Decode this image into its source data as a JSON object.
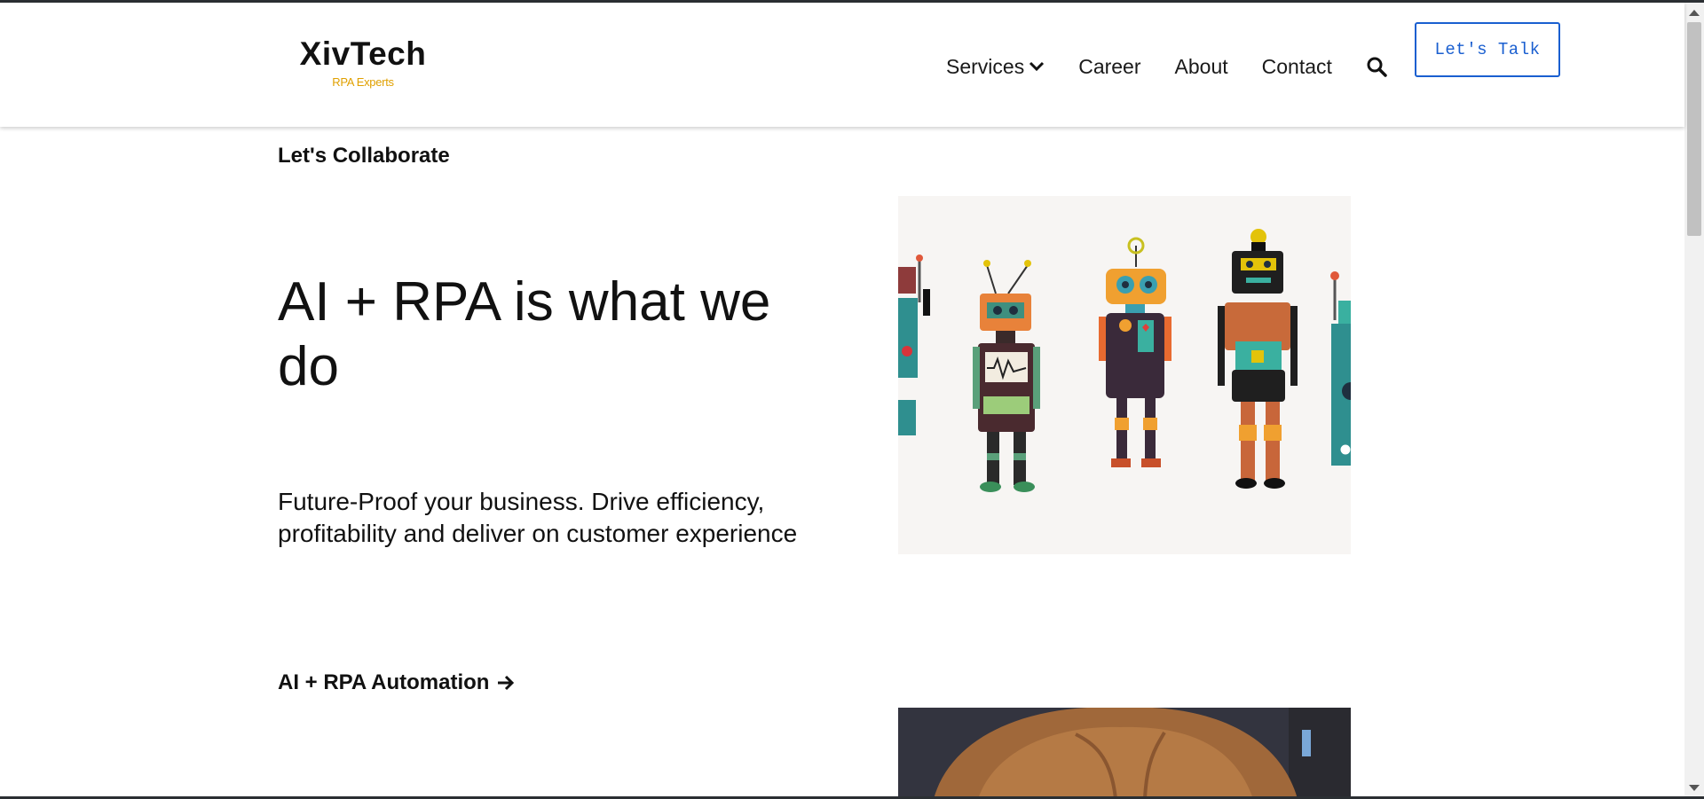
{
  "header": {
    "logo_name": "XivTech",
    "logo_tagline": "RPA Experts",
    "nav": {
      "services": "Services",
      "career": "Career",
      "about": "About",
      "contact": "Contact"
    },
    "cta_button": "Let's Talk",
    "icons": {
      "services_dropdown": "chevron-down-icon",
      "search": "search-icon"
    }
  },
  "hero": {
    "eyebrow": "Let's Collaborate",
    "title": "AI + RPA is what we do",
    "subtitle": "Future-Proof your business. Drive efficiency, profitability and deliver on customer experience",
    "link_label": "AI + RPA Automation",
    "link_icon": "arrow-right-icon"
  },
  "colors": {
    "tagline": "#e0a000",
    "cta_border": "#1a5fd0",
    "text": "#111111",
    "image_bg": "#f7f5f3"
  }
}
